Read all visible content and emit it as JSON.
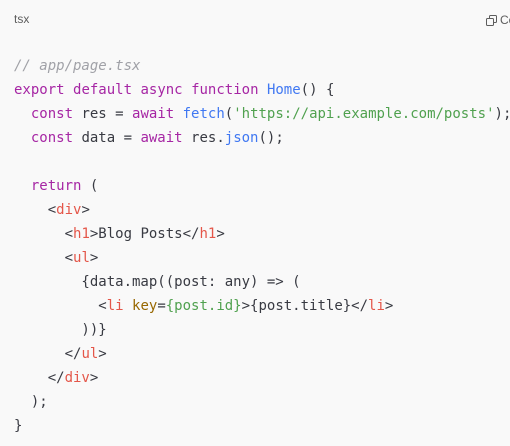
{
  "header": {
    "language": "tsx",
    "copy_label": "Copy"
  },
  "code": {
    "lines": [
      [
        {
          "t": "comment",
          "v": "// app/page.tsx"
        }
      ],
      [
        {
          "t": "keyword",
          "v": "export"
        },
        {
          "t": "plain",
          "v": " "
        },
        {
          "t": "keyword",
          "v": "default"
        },
        {
          "t": "plain",
          "v": " "
        },
        {
          "t": "keyword",
          "v": "async"
        },
        {
          "t": "plain",
          "v": " "
        },
        {
          "t": "keyword",
          "v": "function"
        },
        {
          "t": "plain",
          "v": " "
        },
        {
          "t": "func",
          "v": "Home"
        },
        {
          "t": "plain",
          "v": "() {"
        }
      ],
      [
        {
          "t": "plain",
          "v": "  "
        },
        {
          "t": "keyword",
          "v": "const"
        },
        {
          "t": "plain",
          "v": " res = "
        },
        {
          "t": "keyword",
          "v": "await"
        },
        {
          "t": "plain",
          "v": " "
        },
        {
          "t": "func",
          "v": "fetch"
        },
        {
          "t": "plain",
          "v": "("
        },
        {
          "t": "string",
          "v": "'https://api.example.com/posts'"
        },
        {
          "t": "plain",
          "v": ");"
        }
      ],
      [
        {
          "t": "plain",
          "v": "  "
        },
        {
          "t": "keyword",
          "v": "const"
        },
        {
          "t": "plain",
          "v": " data = "
        },
        {
          "t": "keyword",
          "v": "await"
        },
        {
          "t": "plain",
          "v": " res."
        },
        {
          "t": "func",
          "v": "json"
        },
        {
          "t": "plain",
          "v": "();"
        }
      ],
      [],
      [
        {
          "t": "plain",
          "v": "  "
        },
        {
          "t": "keyword",
          "v": "return"
        },
        {
          "t": "plain",
          "v": " ("
        }
      ],
      [
        {
          "t": "plain",
          "v": "    <"
        },
        {
          "t": "tag",
          "v": "div"
        },
        {
          "t": "plain",
          "v": ">"
        }
      ],
      [
        {
          "t": "plain",
          "v": "      <"
        },
        {
          "t": "tag",
          "v": "h1"
        },
        {
          "t": "plain",
          "v": ">Blog Posts</"
        },
        {
          "t": "tag",
          "v": "h1"
        },
        {
          "t": "plain",
          "v": ">"
        }
      ],
      [
        {
          "t": "plain",
          "v": "      <"
        },
        {
          "t": "tag",
          "v": "ul"
        },
        {
          "t": "plain",
          "v": ">"
        }
      ],
      [
        {
          "t": "plain",
          "v": "        {data.map((post: any) => ("
        }
      ],
      [
        {
          "t": "plain",
          "v": "          <"
        },
        {
          "t": "tag",
          "v": "li"
        },
        {
          "t": "plain",
          "v": " "
        },
        {
          "t": "attr",
          "v": "key"
        },
        {
          "t": "plain",
          "v": "="
        },
        {
          "t": "string",
          "v": "{post.id}"
        },
        {
          "t": "plain",
          "v": ">{post.title}</"
        },
        {
          "t": "tag",
          "v": "li"
        },
        {
          "t": "plain",
          "v": ">"
        }
      ],
      [
        {
          "t": "plain",
          "v": "        ))}"
        }
      ],
      [
        {
          "t": "plain",
          "v": "      </"
        },
        {
          "t": "tag",
          "v": "ul"
        },
        {
          "t": "plain",
          "v": ">"
        }
      ],
      [
        {
          "t": "plain",
          "v": "    </"
        },
        {
          "t": "tag",
          "v": "div"
        },
        {
          "t": "plain",
          "v": ">"
        }
      ],
      [
        {
          "t": "plain",
          "v": "  );"
        }
      ],
      [
        {
          "t": "plain",
          "v": "}"
        }
      ]
    ]
  }
}
